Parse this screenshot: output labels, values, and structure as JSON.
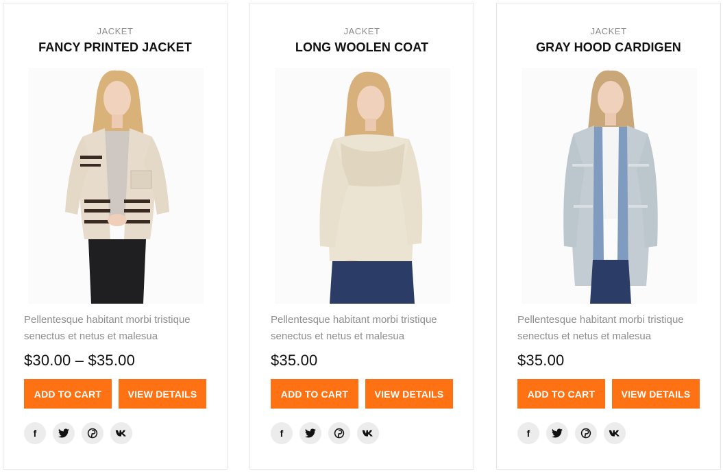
{
  "products": [
    {
      "category": "JACKET",
      "title": "FANCY PRINTED JACKET",
      "description": "Pellentesque habitant morbi tristique senectus et netus et malesua",
      "price": "$30.00 – $35.00",
      "add_to_cart_label": "ADD TO CART",
      "view_details_label": "VIEW DETAILS",
      "image_icon": "model-in-striped-jacket-photo"
    },
    {
      "category": "JACKET",
      "title": "LONG WOOLEN COAT",
      "description": "Pellentesque habitant morbi tristique senectus et netus et malesua",
      "price": "$35.00",
      "add_to_cart_label": "ADD TO CART",
      "view_details_label": "VIEW DETAILS",
      "image_icon": "model-in-cream-sweater-photo"
    },
    {
      "category": "JACKET",
      "title": "GRAY HOOD CARDIGEN",
      "description": "Pellentesque habitant morbi tristique senectus et netus et malesua",
      "price": "$35.00",
      "add_to_cart_label": "ADD TO CART",
      "view_details_label": "VIEW DETAILS",
      "image_icon": "model-in-gray-cardigan-photo"
    }
  ],
  "social_icons": [
    "facebook-icon",
    "twitter-icon",
    "pinterest-icon",
    "vk-icon"
  ],
  "colors": {
    "accent": "#ff7214",
    "title": "#111111",
    "muted": "#8d8d8d",
    "icon_bg": "#ececec"
  }
}
